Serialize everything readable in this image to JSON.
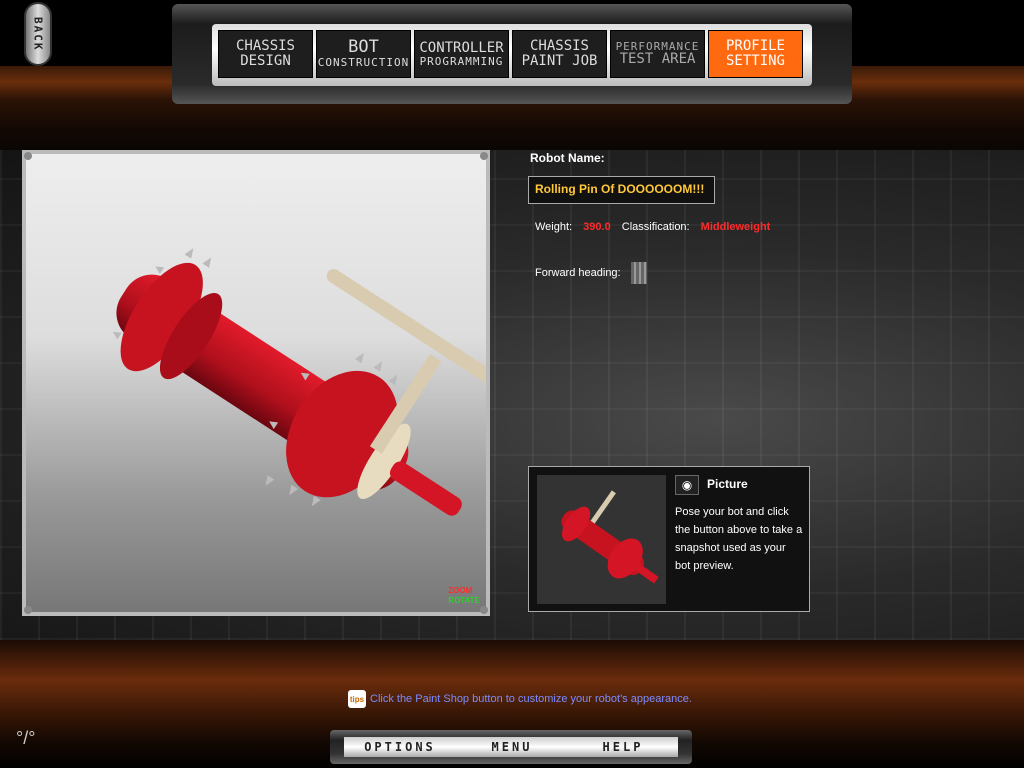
{
  "back": {
    "label": "BACK"
  },
  "nav": {
    "tabs": [
      {
        "line1": "CHASSIS",
        "line2": "DESIGN"
      },
      {
        "line1": "BOT",
        "line2": "CONSTRUCTION"
      },
      {
        "line1": "CONTROLLER",
        "line2": "PROGRAMMING"
      },
      {
        "line1": "CHASSIS",
        "line2": "PAINT JOB"
      },
      {
        "line1": "PERFORMANCE",
        "line2": "TEST AREA"
      },
      {
        "line1": "PROFILE",
        "line2": "SETTING"
      }
    ],
    "active_index": 5
  },
  "viewport": {
    "legend": {
      "zoom": "ZOOM",
      "rotate": "ROTATE"
    }
  },
  "robot": {
    "name_label": "Robot Name:",
    "name_value": "Rolling Pin Of DOOOOOOM!!!",
    "weight_label": "Weight:",
    "weight_value": "390.0",
    "class_label": "Classification:",
    "class_value": "Middleweight",
    "heading_label": "Forward heading:"
  },
  "picture": {
    "title": "Picture",
    "camera_icon": "camera-icon",
    "description": "Pose your bot and click the button above to take a snapshot used as your bot preview."
  },
  "tip": {
    "icon_label": "tips",
    "text": "Click the Paint Shop button to customize your robot's appearance."
  },
  "bottom_menu": {
    "options": "OPTIONS",
    "menu": "MENU",
    "help": "HELP"
  },
  "version_glyph": "°/°",
  "colors": {
    "accent": "#ff6a10",
    "name_text": "#ffc83a",
    "stat_red": "#ff2b2b",
    "tip_text": "#7c8cff"
  }
}
